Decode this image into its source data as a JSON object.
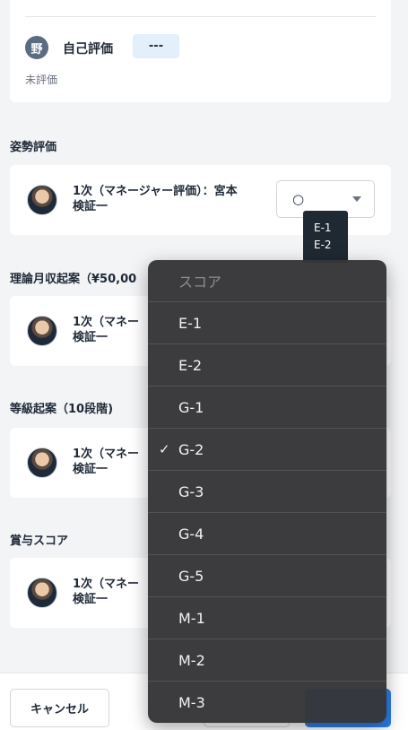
{
  "self_eval": {
    "avatar_initial": "野",
    "label": "自己評価",
    "badge": "---",
    "status": "未評価"
  },
  "sections": [
    {
      "title": "姿勢評価",
      "evaluator_line1": "1次（マネージャー評価）：宮本",
      "evaluator_line2": "検証一",
      "value": "○"
    },
    {
      "title": "理論月収起案（¥50,00",
      "evaluator_line1": "1次（マネー",
      "evaluator_line2": "検証一"
    },
    {
      "title": "等級起案（10段階)",
      "evaluator_line1": "1次（マネー",
      "evaluator_line2": "検証一"
    },
    {
      "title": "賞与スコア",
      "evaluator_line1": "1次（マネー",
      "evaluator_line2": "検証一"
    }
  ],
  "tooltip": {
    "line1": "E-1",
    "line2": "E-2"
  },
  "dropdown": {
    "header": "スコア",
    "options": [
      "E-1",
      "E-2",
      "G-1",
      "G-2",
      "G-3",
      "G-4",
      "G-5",
      "M-1",
      "M-2",
      "M-3"
    ],
    "selected": "G-2",
    "check_glyph": "✓"
  },
  "footer": {
    "cancel_label": "キャンセル"
  }
}
